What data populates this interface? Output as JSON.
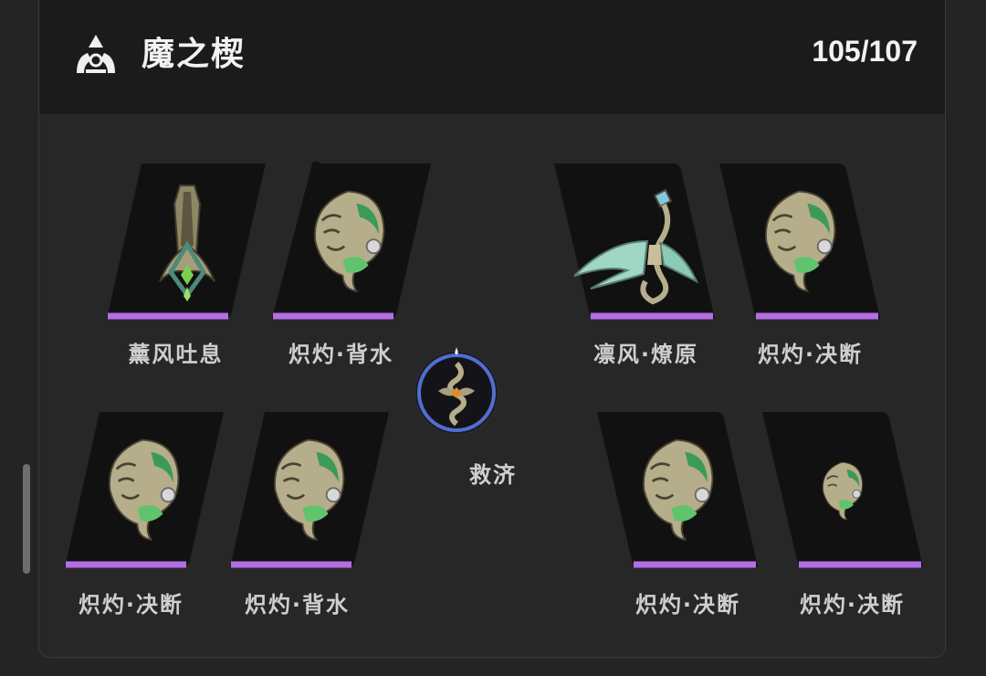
{
  "header": {
    "title": "魔之楔",
    "count": "105/107",
    "logo_icon": "triad-logo-icon"
  },
  "colors": {
    "rarity_bar": "#b46ee6",
    "card_bg": "#111111",
    "center_ring": "#4f6fd0"
  },
  "slots": [
    {
      "label": "薰风吐息",
      "icon": "emblem-pendant-icon"
    },
    {
      "label": "炽灼·背水",
      "icon": "mask-emblem-icon"
    },
    {
      "label": "凛风·燎原",
      "icon": "phoenix-emblem-icon"
    },
    {
      "label": "炽灼·决断",
      "icon": "mask-emblem-icon"
    },
    {
      "label": "炽灼·决断",
      "icon": "mask-emblem-icon"
    },
    {
      "label": "炽灼·背水",
      "icon": "mask-emblem-icon"
    },
    {
      "label": "炽灼·决断",
      "icon": "mask-emblem-icon"
    },
    {
      "label": "炽灼·决断",
      "icon": "mask-emblem-icon"
    }
  ],
  "center": {
    "label": "救济",
    "icon": "serpent-emblem-icon"
  }
}
